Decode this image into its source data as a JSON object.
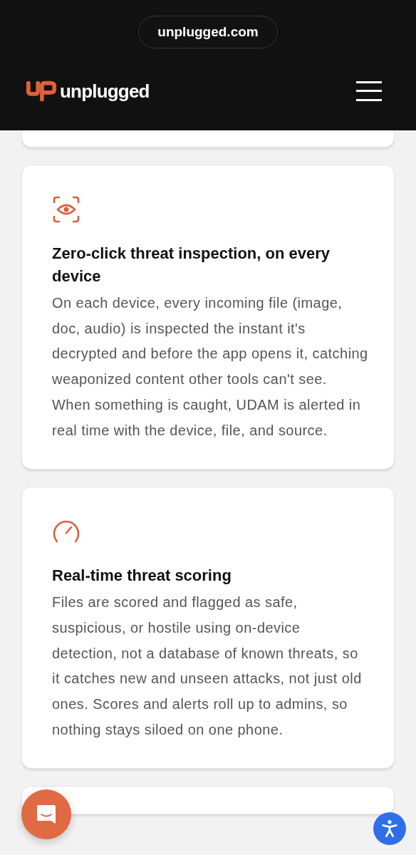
{
  "browser": {
    "address": "unplugged.com"
  },
  "header": {
    "brand": "unplugged"
  },
  "features": [
    {
      "title": "Zero-click threat inspection, on every device",
      "body": "On each device, every incoming file (image, doc, audio) is inspected the instant it's decrypted and before the app opens it, catching weaponized content other tools can't see. When something is caught, UDAM is alerted in real time with the device, file, and source."
    },
    {
      "title": "Real-time threat scoring",
      "body": "Files are scored and flagged as safe, suspicious, or hostile using on-device detection, not a database of known threats, so it catches new and unseen attacks, not just old ones. Scores and alerts roll up to admins, so nothing stays siloed on one phone."
    }
  ]
}
